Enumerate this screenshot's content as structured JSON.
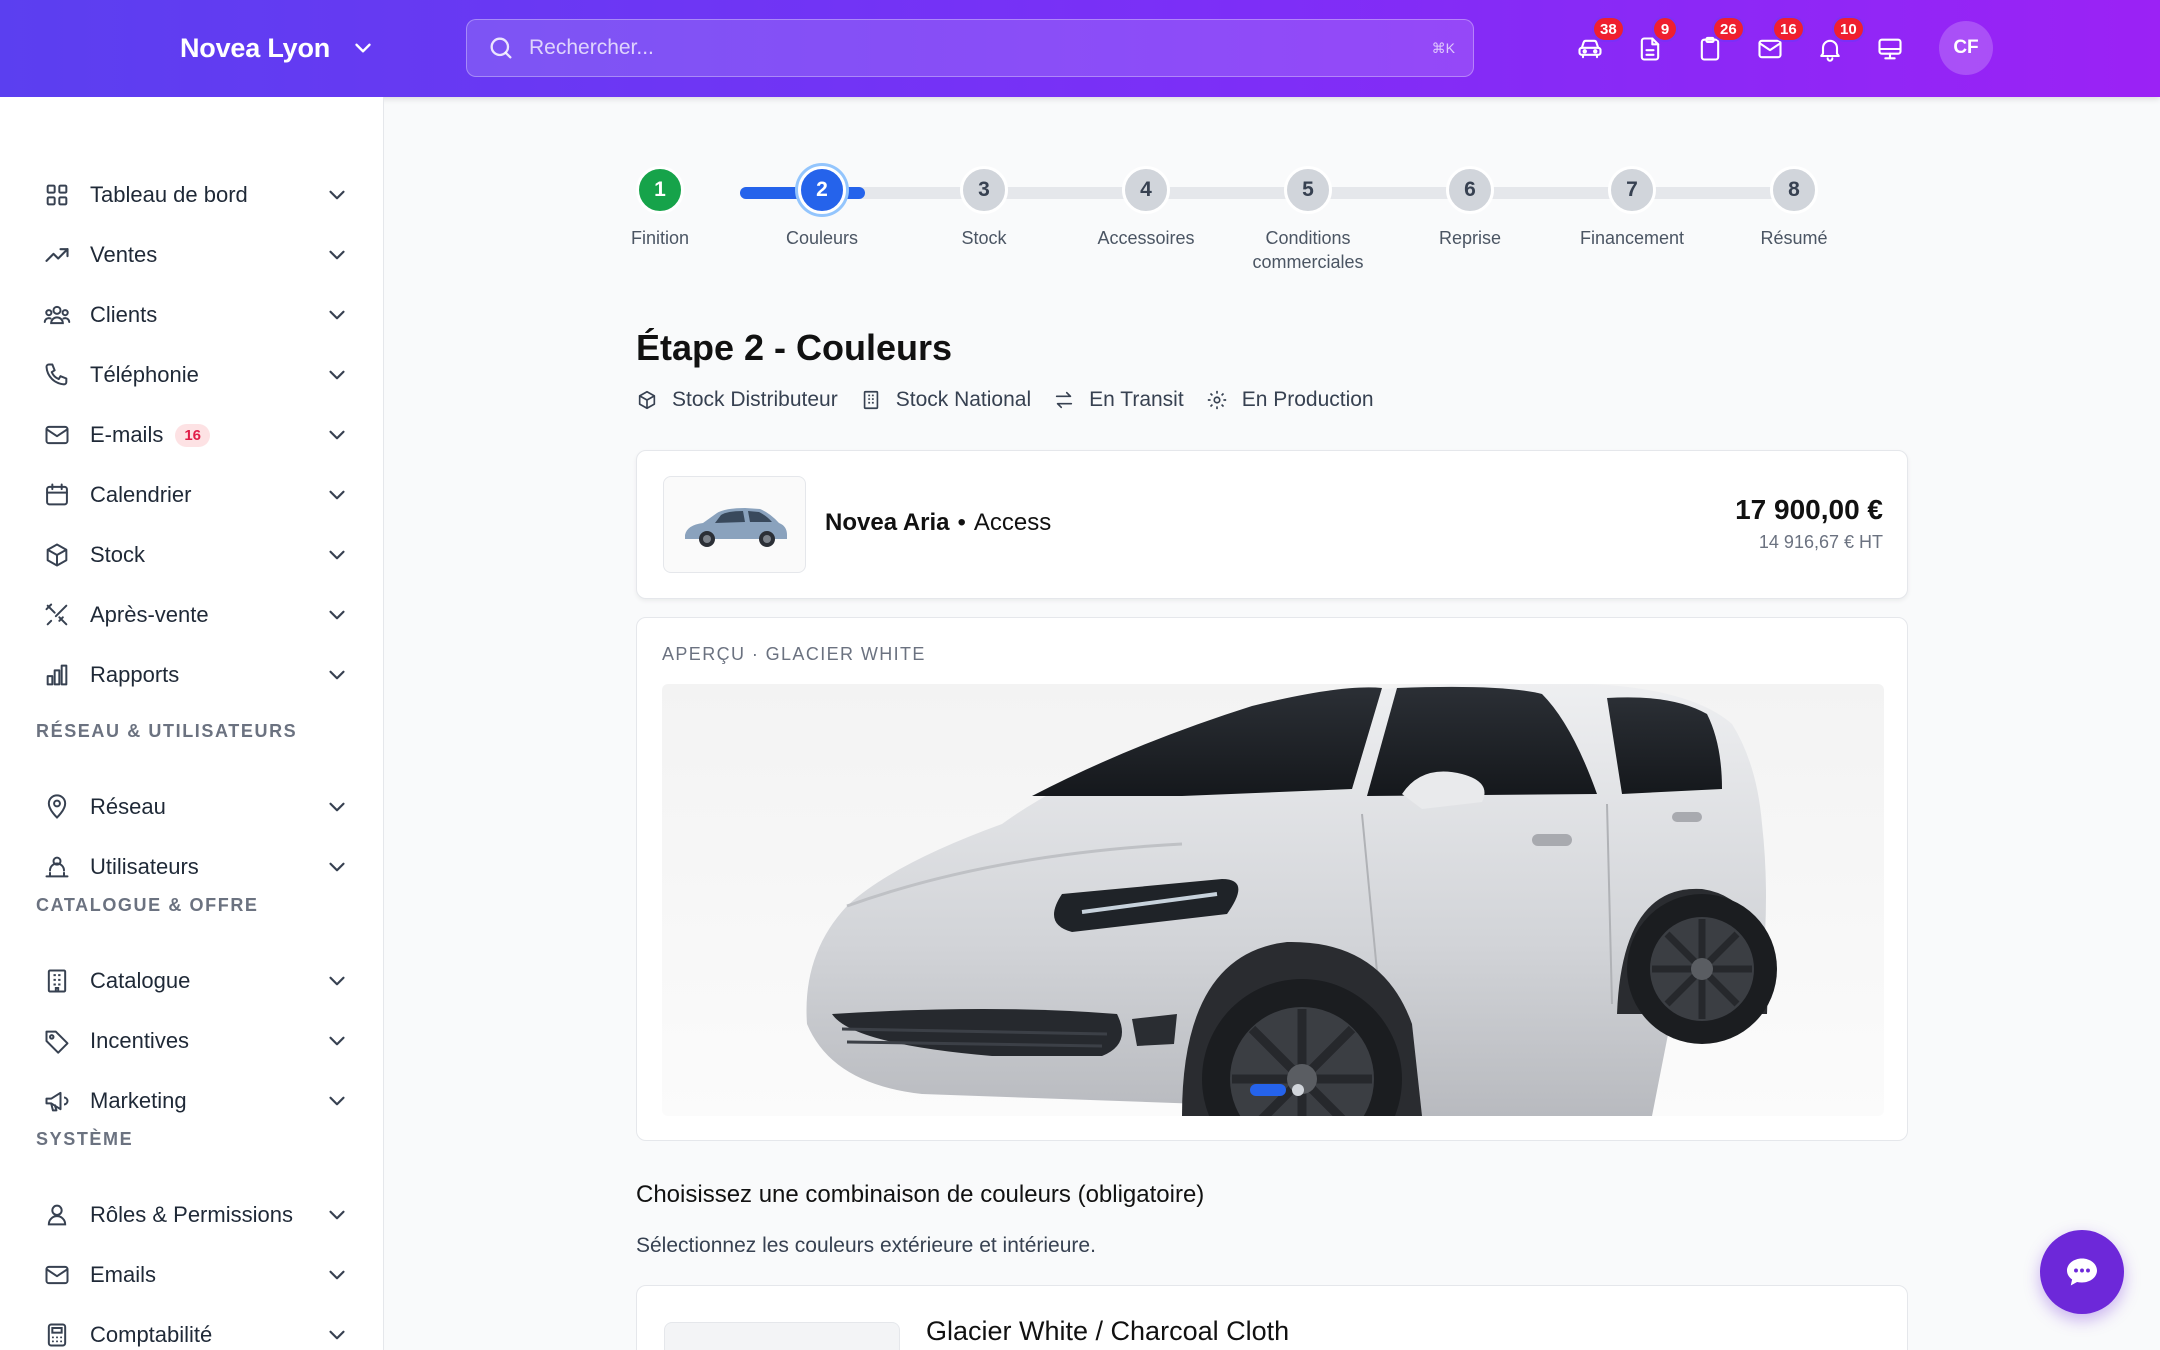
{
  "header": {
    "brand": "Novea Lyon",
    "search_placeholder": "Rechercher...",
    "search_shortcut": "⌘K",
    "icons": [
      {
        "name": "car-icon",
        "badge": "38"
      },
      {
        "name": "document-icon",
        "badge": "9"
      },
      {
        "name": "clipboard-icon",
        "badge": "26"
      },
      {
        "name": "mail-icon",
        "badge": "16"
      },
      {
        "name": "bell-icon",
        "badge": "10"
      },
      {
        "name": "monitor-icon",
        "badge": ""
      }
    ],
    "avatar_initials": "CF"
  },
  "sidebar": {
    "items": [
      {
        "label": "Tableau de bord",
        "icon": "dashboard-icon"
      },
      {
        "label": "Ventes",
        "icon": "trend-icon"
      },
      {
        "label": "Clients",
        "icon": "users-icon"
      },
      {
        "label": "Téléphonie",
        "icon": "phone-icon"
      },
      {
        "label": "E-mails",
        "icon": "mail-icon",
        "badge": "16"
      },
      {
        "label": "Calendrier",
        "icon": "calendar-icon"
      },
      {
        "label": "Stock",
        "icon": "box-icon"
      },
      {
        "label": "Après-vente",
        "icon": "tools-icon"
      },
      {
        "label": "Rapports",
        "icon": "chart-icon"
      }
    ],
    "section_network": "RÉSEAU & UTILISATEURS",
    "network_items": [
      {
        "label": "Réseau",
        "icon": "location-icon"
      },
      {
        "label": "Utilisateurs",
        "icon": "user-group-icon"
      }
    ],
    "section_catalogue": "CATALOGUE & OFFRE",
    "catalogue_items": [
      {
        "label": "Catalogue",
        "icon": "building-icon"
      },
      {
        "label": "Incentives",
        "icon": "tag-icon"
      },
      {
        "label": "Marketing",
        "icon": "megaphone-icon"
      }
    ],
    "section_system": "SYSTÈME",
    "system_items": [
      {
        "label": "Rôles & Permissions",
        "icon": "user-icon"
      },
      {
        "label": "Emails",
        "icon": "mail-icon"
      },
      {
        "label": "Comptabilité",
        "icon": "calculator-icon"
      }
    ]
  },
  "stepper": {
    "steps": [
      {
        "num": "1",
        "label": "Finition",
        "state": "done"
      },
      {
        "num": "2",
        "label": "Couleurs",
        "state": "active"
      },
      {
        "num": "3",
        "label": "Stock",
        "state": "pending"
      },
      {
        "num": "4",
        "label": "Accessoires",
        "state": "pending"
      },
      {
        "num": "5",
        "label": "Conditions commerciales",
        "state": "pending"
      },
      {
        "num": "6",
        "label": "Reprise",
        "state": "pending"
      },
      {
        "num": "7",
        "label": "Financement",
        "state": "pending"
      },
      {
        "num": "8",
        "label": "Résumé",
        "state": "pending"
      }
    ]
  },
  "page": {
    "title": "Étape 2 - Couleurs",
    "stock_filters": [
      {
        "label": "Stock Distributeur",
        "icon": "box-icon"
      },
      {
        "label": "Stock National",
        "icon": "building-icon"
      },
      {
        "label": "En Transit",
        "icon": "arrows-icon"
      },
      {
        "label": "En Production",
        "icon": "gear-icon"
      }
    ]
  },
  "vehicle": {
    "model": "Novea Aria",
    "separator": "•",
    "trim": "Access",
    "price_ttc": "17 900,00 €",
    "price_ht": "14 916,67 € HT"
  },
  "preview": {
    "label": "APERÇU · GLACIER WHITE"
  },
  "colors": {
    "title": "Choisissez une combinaison de couleurs (obligatoire)",
    "subtitle": "Sélectionnez les couleurs extérieure et intérieure.",
    "first_option": "Glacier White / Charcoal Cloth"
  },
  "theme": {
    "header_start": "#5b3ff0",
    "header_end": "#9b22f5",
    "accent": "#2563eb",
    "done": "#16a34a",
    "badge": "#ef1f2f"
  }
}
